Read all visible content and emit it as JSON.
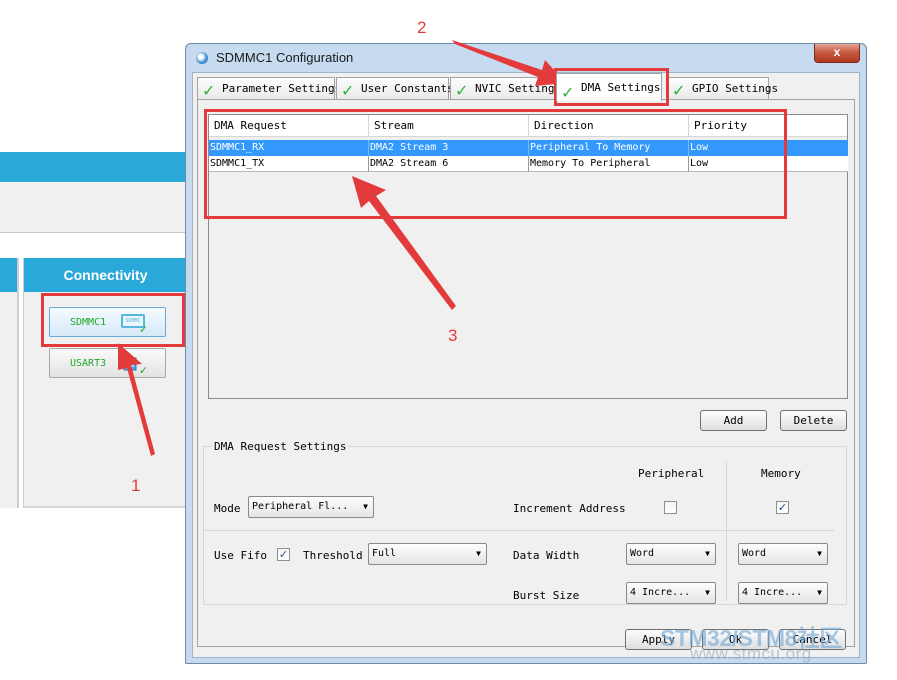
{
  "background_app": {
    "connectivity_header": "Connectivity",
    "peripherals": [
      {
        "label": "SDMMC1",
        "icon": "sd-card-icon",
        "chip_text": "SDMMC",
        "status": "configured",
        "selected": true
      },
      {
        "label": "USART3",
        "icon": "uart-icon",
        "status": "configured",
        "selected": false
      }
    ]
  },
  "dialog": {
    "title": "SDMMC1 Configuration",
    "close_label": "x",
    "tabs": [
      {
        "label": "Parameter Settings",
        "status_icon": "check-icon",
        "active": false
      },
      {
        "label": "User Constants",
        "status_icon": "check-icon",
        "active": false
      },
      {
        "label": "NVIC Settings",
        "status_icon": "check-icon",
        "active": false
      },
      {
        "label": "DMA Settings",
        "status_icon": "check-icon",
        "active": true
      },
      {
        "label": "GPIO Settings",
        "status_icon": "check-icon",
        "active": false
      }
    ],
    "dma_table": {
      "columns": [
        "DMA Request",
        "Stream",
        "Direction",
        "Priority"
      ],
      "rows": [
        {
          "request": "SDMMC1_RX",
          "stream": "DMA2 Stream 3",
          "direction": "Peripheral To Memory",
          "priority": "Low",
          "selected": true
        },
        {
          "request": "SDMMC1_TX",
          "stream": "DMA2 Stream 6",
          "direction": "Memory To Peripheral",
          "priority": "Low",
          "selected": false
        }
      ]
    },
    "buttons": {
      "add": "Add",
      "delete": "Delete",
      "apply": "Apply",
      "ok": "Ok",
      "cancel": "Cancel"
    },
    "request_settings": {
      "title": "DMA Request Settings",
      "peripheral_header": "Peripheral",
      "memory_header": "Memory",
      "mode_label": "Mode",
      "mode_value": "Peripheral Fl...",
      "increment_label": "Increment Address",
      "increment_peripheral": false,
      "increment_memory": true,
      "use_fifo_label": "Use Fifo",
      "use_fifo": true,
      "threshold_label": "Threshold",
      "threshold_value": "Full",
      "data_width_label": "Data Width",
      "data_width_peripheral": "Word",
      "data_width_memory": "Word",
      "burst_size_label": "Burst Size",
      "burst_size_peripheral": "4 Incre...",
      "burst_size_memory": "4 Incre..."
    }
  },
  "annotations": {
    "labels": [
      "1",
      "2",
      "3"
    ],
    "color": "#e33b3b"
  },
  "watermark": {
    "line1": "STM32/STM8社区",
    "line2": "www.stmcu.org"
  },
  "colors": {
    "accent_blue": "#29a9d9",
    "selection": "#3399ff",
    "check_green": "#2fb03c",
    "dialog_frame": "#c6dbef"
  }
}
